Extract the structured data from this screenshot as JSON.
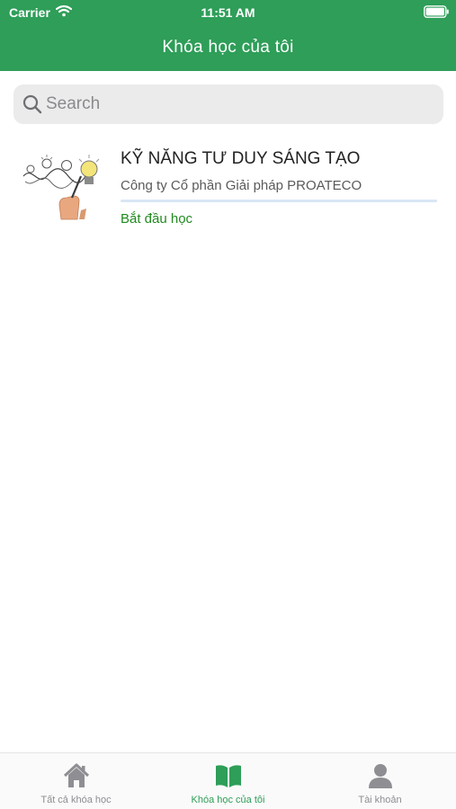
{
  "status_bar": {
    "carrier": "Carrier",
    "time": "11:51 AM",
    "icons": [
      "wifi-icon",
      "battery-icon"
    ]
  },
  "nav": {
    "title": "Khóa học của tôi"
  },
  "search": {
    "placeholder": "Search",
    "value": ""
  },
  "courses": [
    {
      "title": "KỸ NĂNG TƯ DUY SÁNG TẠO",
      "provider": "Công ty Cổ phần Giải pháp PROATECO",
      "progress_fraction": 0,
      "action_label": "Bắt đầu học"
    }
  ],
  "tabs": [
    {
      "label": "Tất cả khóa học",
      "icon": "home-icon",
      "active": false
    },
    {
      "label": "Khóa học của tôi",
      "icon": "book-icon",
      "active": true
    },
    {
      "label": "Tài khoản",
      "icon": "user-icon",
      "active": false
    }
  ],
  "colors": {
    "brand_green": "#2e9e58",
    "action_green": "#1f8a1f",
    "tab_inactive": "#8e8e93",
    "progress_track": "#d9e6f5"
  }
}
